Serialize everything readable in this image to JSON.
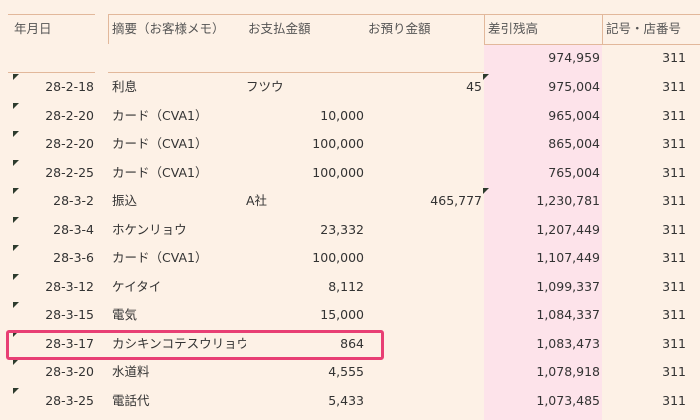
{
  "headers": {
    "date": "年月日",
    "memo": "摘要（お客様メモ）",
    "payment": "お支払金額",
    "deposit": "お預り金額",
    "balance": "差引残高",
    "code": "記号・店番号"
  },
  "opening": {
    "balance": "974,959",
    "code": "311"
  },
  "rows": [
    {
      "date": "28-2-18",
      "memo": "利息",
      "payment": "フツウ",
      "deposit": "45",
      "balance": "975,004",
      "code": "311"
    },
    {
      "date": "28-2-20",
      "memo": "カード（CVA1）",
      "payment": "10,000",
      "deposit": "",
      "balance": "965,004",
      "code": "311"
    },
    {
      "date": "28-2-20",
      "memo": "カード（CVA1）",
      "payment": "100,000",
      "deposit": "",
      "balance": "865,004",
      "code": "311"
    },
    {
      "date": "28-2-25",
      "memo": "カード（CVA1）",
      "payment": "100,000",
      "deposit": "",
      "balance": "765,004",
      "code": "311"
    },
    {
      "date": "28-3-2",
      "memo": "振込",
      "payment": "A社",
      "deposit": "465,777",
      "balance": "1,230,781",
      "code": "311"
    },
    {
      "date": "28-3-4",
      "memo": "ホケンリョウ",
      "payment": "23,332",
      "deposit": "",
      "balance": "1,207,449",
      "code": "311"
    },
    {
      "date": "28-3-6",
      "memo": "カード（CVA1）",
      "payment": "100,000",
      "deposit": "",
      "balance": "1,107,449",
      "code": "311"
    },
    {
      "date": "28-3-12",
      "memo": "ケイタイ",
      "payment": "8,112",
      "deposit": "",
      "balance": "1,099,337",
      "code": "311"
    },
    {
      "date": "28-3-15",
      "memo": "電気",
      "payment": "15,000",
      "deposit": "",
      "balance": "1,084,337",
      "code": "311"
    },
    {
      "date": "28-3-17",
      "memo": "カシキンコテスウリョウ",
      "payment": "864",
      "deposit": "",
      "balance": "1,083,473",
      "code": "311"
    },
    {
      "date": "28-3-20",
      "memo": "水道料",
      "payment": "4,555",
      "deposit": "",
      "balance": "1,078,918",
      "code": "311"
    },
    {
      "date": "28-3-25",
      "memo": "電話代",
      "payment": "5,433",
      "deposit": "",
      "balance": "1,073,485",
      "code": "311"
    }
  ]
}
